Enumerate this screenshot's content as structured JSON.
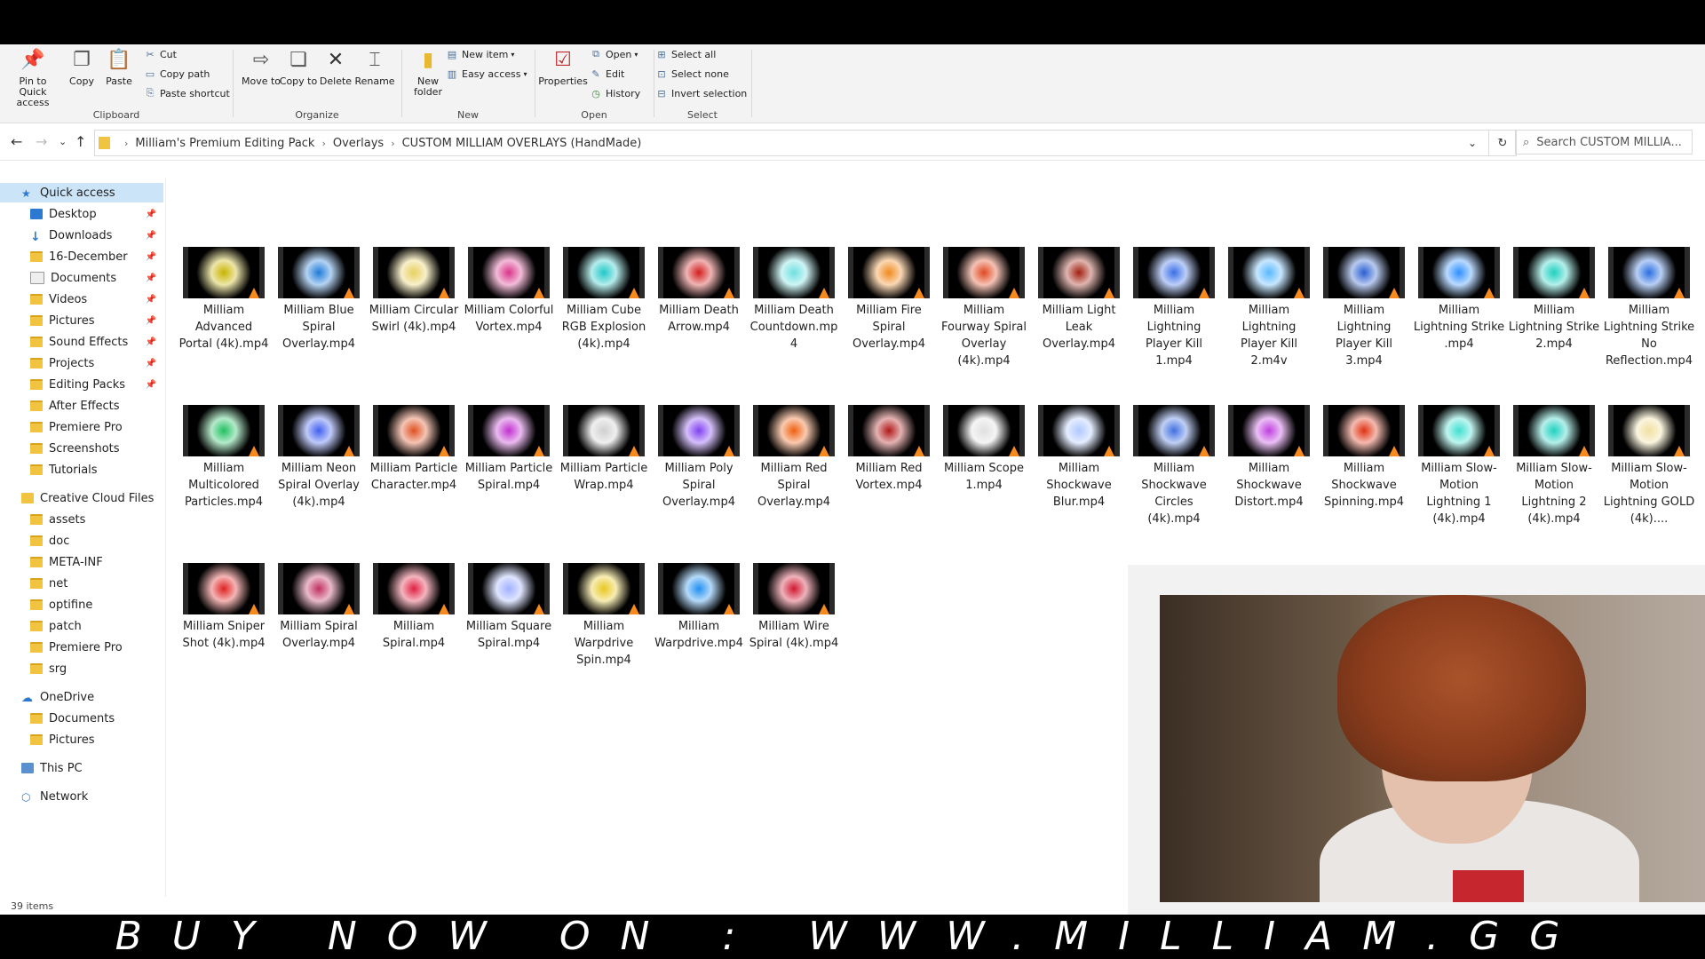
{
  "ribbon": {
    "clipboard": {
      "label": "Clipboard",
      "pin": "Pin to Quick access",
      "copy": "Copy",
      "paste": "Paste",
      "cut": "Cut",
      "copy_path": "Copy path",
      "paste_shortcut": "Paste shortcut"
    },
    "organize": {
      "label": "Organize",
      "move_to": "Move to",
      "copy_to": "Copy to",
      "delete": "Delete",
      "rename": "Rename"
    },
    "new": {
      "label": "New",
      "new_folder": "New folder",
      "new_item": "New item",
      "easy_access": "Easy access"
    },
    "open": {
      "label": "Open",
      "properties": "Properties",
      "open": "Open",
      "edit": "Edit",
      "history": "History"
    },
    "select": {
      "label": "Select",
      "select_all": "Select all",
      "select_none": "Select none",
      "invert": "Invert selection"
    }
  },
  "address": {
    "crumbs": [
      "Milliam's Premium Editing Pack",
      "Overlays",
      "CUSTOM MILLIAM OVERLAYS (HandMade)"
    ],
    "search_placeholder": "Search CUSTOM MILLIA..."
  },
  "nav": [
    {
      "label": "Quick access",
      "icon": "star-icon"
    },
    {
      "label": "Desktop",
      "icon": "desktop-icon",
      "pinned": true
    },
    {
      "label": "Downloads",
      "icon": "download-icon",
      "pinned": true
    },
    {
      "label": "16-December",
      "icon": "folder-icon",
      "pinned": true
    },
    {
      "label": "Documents",
      "icon": "documents-icon",
      "pinned": true
    },
    {
      "label": "Videos",
      "icon": "folder-icon",
      "pinned": true
    },
    {
      "label": "Pictures",
      "icon": "folder-icon",
      "pinned": true
    },
    {
      "label": "Sound Effects",
      "icon": "folder-icon",
      "pinned": true
    },
    {
      "label": "Projects",
      "icon": "folder-icon",
      "pinned": true
    },
    {
      "label": "Editing Packs",
      "icon": "folder-icon",
      "pinned": true
    },
    {
      "label": "After Effects",
      "icon": "folder-icon"
    },
    {
      "label": "Premiere Pro",
      "icon": "folder-icon"
    },
    {
      "label": "Screenshots",
      "icon": "folder-icon"
    },
    {
      "label": "Tutorials",
      "icon": "folder-icon"
    },
    {
      "label": "Creative Cloud Files",
      "icon": "creative-cloud-icon"
    },
    {
      "label": "assets",
      "icon": "folder-icon"
    },
    {
      "label": "doc",
      "icon": "folder-icon"
    },
    {
      "label": "META-INF",
      "icon": "folder-icon"
    },
    {
      "label": "net",
      "icon": "folder-icon"
    },
    {
      "label": "optifine",
      "icon": "folder-icon"
    },
    {
      "label": "patch",
      "icon": "folder-icon"
    },
    {
      "label": "Premiere Pro",
      "icon": "folder-icon"
    },
    {
      "label": "srg",
      "icon": "folder-icon"
    },
    {
      "label": "OneDrive",
      "icon": "cloud-icon"
    },
    {
      "label": "Documents",
      "icon": "folder-icon"
    },
    {
      "label": "Pictures",
      "icon": "folder-icon"
    },
    {
      "label": "This PC",
      "icon": "pc-icon"
    },
    {
      "label": "Network",
      "icon": "network-icon"
    }
  ],
  "files": [
    {
      "name": "Milliam Advanced Portal (4k).mp4",
      "color": "#c8b400"
    },
    {
      "name": "Milliam Blue Spiral Overlay.mp4",
      "color": "#1e7bd9"
    },
    {
      "name": "Milliam Circular Swirl (4k).mp4",
      "color": "#e8d060"
    },
    {
      "name": "Milliam Colorful Vortex.mp4",
      "color": "#d9358a"
    },
    {
      "name": "Milliam Cube RGB Explosion (4k).mp4",
      "color": "#22c8c8"
    },
    {
      "name": "Milliam Death Arrow.mp4",
      "color": "#d21e1e"
    },
    {
      "name": "Milliam Death Countdown.mp4",
      "color": "#6fe0e0"
    },
    {
      "name": "Milliam Fire Spiral Overlay.mp4",
      "color": "#f08a1e"
    },
    {
      "name": "Milliam Fourway Spiral Overlay (4k).mp4",
      "color": "#e04820"
    },
    {
      "name": "Milliam Light Leak Overlay.mp4",
      "color": "#a02010"
    },
    {
      "name": "Milliam Lightning Player Kill 1.mp4",
      "color": "#3a6fe8"
    },
    {
      "name": "Milliam Lightning Player Kill 2.m4v",
      "color": "#58b8ff"
    },
    {
      "name": "Milliam Lightning Player Kill 3.mp4",
      "color": "#2a5fd0"
    },
    {
      "name": "Milliam Lightning Strike .mp4",
      "color": "#2e8fff"
    },
    {
      "name": "Milliam Lightning Strike 2.mp4",
      "color": "#1ed0c0"
    },
    {
      "name": "Milliam Lightning Strike No Reflection.mp4",
      "color": "#2a6fe0"
    },
    {
      "name": "Milliam Multicolored Particles.mp4",
      "color": "#20c060"
    },
    {
      "name": "Milliam Neon Spiral Overlay (4k).mp4",
      "color": "#4060f0"
    },
    {
      "name": "Milliam Particle Character.mp4",
      "color": "#e05020"
    },
    {
      "name": "Milliam Particle Spiral.mp4",
      "color": "#c030d0"
    },
    {
      "name": "Milliam Particle Wrap.mp4",
      "color": "#d0d0d0"
    },
    {
      "name": "Milliam Poly Spiral Overlay.mp4",
      "color": "#8040f0"
    },
    {
      "name": "Milliam Red Spiral Overlay.mp4",
      "color": "#f06010"
    },
    {
      "name": "Milliam Red Vortex.mp4",
      "color": "#b01818"
    },
    {
      "name": "Milliam Scope 1.mp4",
      "color": "#e0e0e0"
    },
    {
      "name": "Milliam Shockwave Blur.mp4",
      "color": "#b0c8ff"
    },
    {
      "name": "Milliam Shockwave Circles (4k).mp4",
      "color": "#4070e0"
    },
    {
      "name": "Milliam Shockwave Distort.mp4",
      "color": "#c040e0"
    },
    {
      "name": "Milliam Shockwave Spinning.mp4",
      "color": "#e03010"
    },
    {
      "name": "Milliam Slow-Motion Lightning 1 (4k).mp4",
      "color": "#40e0d0"
    },
    {
      "name": "Milliam Slow-Motion Lightning 2 (4k).mp4",
      "color": "#20d0c0"
    },
    {
      "name": "Milliam Slow-Motion Lightning GOLD (4k)....",
      "color": "#f0e0a0"
    },
    {
      "name": "Milliam Sniper Shot (4k).mp4",
      "color": "#e02020"
    },
    {
      "name": "Milliam Spiral Overlay.mp4",
      "color": "#c03060"
    },
    {
      "name": "Milliam Spiral.mp4",
      "color": "#e02040"
    },
    {
      "name": "Milliam Square Spiral.mp4",
      "color": "#a0b0ff"
    },
    {
      "name": "Milliam Warpdrive Spin.mp4",
      "color": "#e8c820"
    },
    {
      "name": "Milliam Warpdrive.mp4",
      "color": "#2090f0"
    },
    {
      "name": "Milliam Wire Spiral (4k).mp4",
      "color": "#d01830"
    }
  ],
  "status": "39 items",
  "banner": "BUY NOW ON : WWW.MILLIAM.GG"
}
